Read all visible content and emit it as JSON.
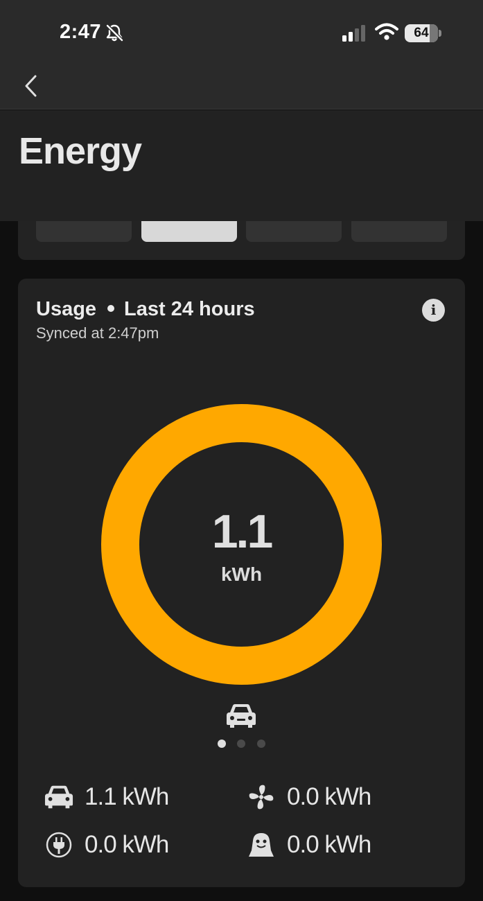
{
  "status_bar": {
    "time": "2:47",
    "battery": "64",
    "icons": [
      "bell-slash-icon",
      "signal-icon",
      "wifi-icon",
      "battery-icon"
    ]
  },
  "nav": {
    "back_icon": "chevron-left-icon"
  },
  "header": {
    "title": "Energy"
  },
  "range_selector": {
    "note": "",
    "active_index": 1
  },
  "usage": {
    "title": "Usage",
    "period": "Last 24 hours",
    "synced": "Synced at 2:47pm",
    "info_label": "i",
    "total_value": "1.1",
    "total_unit": "kWh",
    "ring_color": "#ffa800",
    "center_icon": "car-icon",
    "pager": {
      "count": 3,
      "active": 0
    },
    "metrics": [
      {
        "icon": "car-icon",
        "value": "1.1 kWh"
      },
      {
        "icon": "fan-icon",
        "value": "0.0 kWh"
      },
      {
        "icon": "plug-icon",
        "value": "0.0 kWh"
      },
      {
        "icon": "sentry-icon",
        "value": "0.0 kWh"
      }
    ]
  }
}
